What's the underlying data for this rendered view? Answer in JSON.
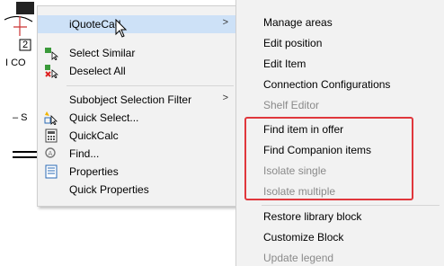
{
  "background": {
    "frag_a": "2",
    "frag_b": "I CO",
    "frag_c": "– S"
  },
  "menu": {
    "items": [
      {
        "label": "iQuoteCad",
        "icon": "none",
        "submenu": true
      },
      {
        "label": "Select Similar",
        "icon": "select-similar-icon"
      },
      {
        "label": "Deselect All",
        "icon": "deselect-all-icon"
      },
      {
        "label": "Subobject Selection Filter",
        "icon": "none",
        "submenu": true
      },
      {
        "label": "Quick Select...",
        "icon": "quick-select-icon"
      },
      {
        "label": "QuickCalc",
        "icon": "calculator-icon"
      },
      {
        "label": "Find...",
        "icon": "find-icon"
      },
      {
        "label": "Properties",
        "icon": "properties-icon"
      },
      {
        "label": "Quick Properties",
        "icon": "none"
      }
    ],
    "arrow": ">"
  },
  "submenu": {
    "items": [
      {
        "label": "Manage areas",
        "disabled": false
      },
      {
        "label": "Edit position",
        "disabled": false
      },
      {
        "label": "Edit Item",
        "disabled": false
      },
      {
        "label": "Connection Configurations",
        "disabled": false
      },
      {
        "label": "Shelf Editor",
        "disabled": true
      },
      {
        "label": "Find item in offer",
        "disabled": false
      },
      {
        "label": "Find Companion items",
        "disabled": false
      },
      {
        "label": "Isolate single",
        "disabled": true
      },
      {
        "label": "Isolate multiple",
        "disabled": true
      },
      {
        "label": "Restore library block",
        "disabled": false
      },
      {
        "label": "Customize Block",
        "disabled": false
      },
      {
        "label": "Update legend",
        "disabled": true
      }
    ]
  },
  "colors": {
    "highlight": "#cde1f7",
    "menu_bg": "#f2f2f2",
    "annotation_red": "#e0373c",
    "disabled_text": "#8a8a8a"
  }
}
